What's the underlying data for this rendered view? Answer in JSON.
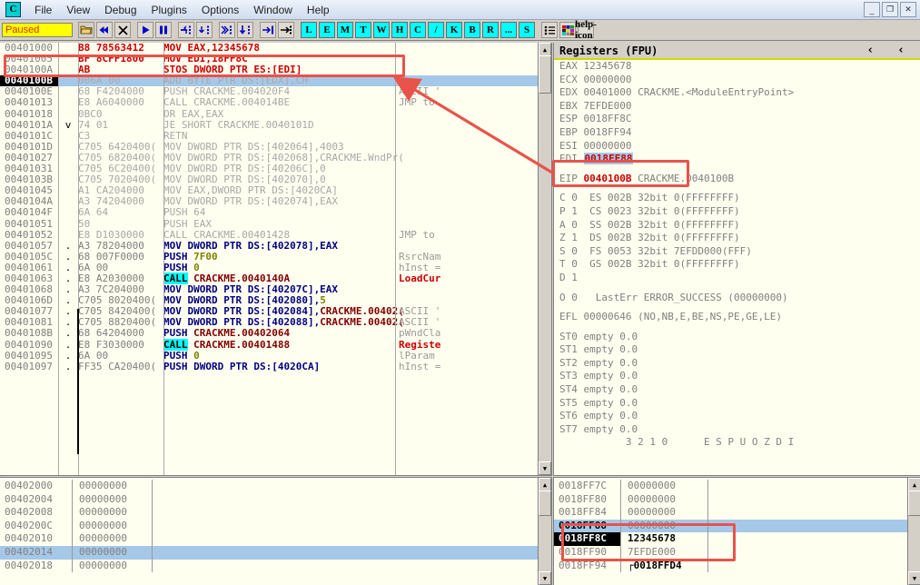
{
  "window": {
    "app_letter": "C",
    "menus": [
      "File",
      "View",
      "Debug",
      "Plugins",
      "Options",
      "Window",
      "Help"
    ],
    "controls": {
      "minimize": "_",
      "restore": "❐",
      "close": "✕"
    }
  },
  "toolbar": {
    "status": "Paused",
    "icons": [
      "open-folder",
      "restart",
      "close",
      "run",
      "pause",
      "step-over",
      "step-into",
      "trace-over",
      "trace-into",
      "execute-till-return",
      "animate"
    ],
    "letters": [
      "L",
      "E",
      "M",
      "T",
      "W",
      "H",
      "C",
      "/",
      "K",
      "B",
      "R",
      "...",
      "S"
    ],
    "extras": [
      "list-icon",
      "colors-icon",
      "help-icon"
    ]
  },
  "disasm": {
    "rows": [
      {
        "addr": "00401000",
        "mark": "",
        "hex": "B8 78563412",
        "hex_style": "red",
        "dis": "MOV EAX,12345678",
        "dis_style": "red",
        "cmt": ""
      },
      {
        "addr": "00401005",
        "mark": "",
        "hex": "BF 8CFF1800",
        "hex_style": "red",
        "dis": "MOV EDI,18FF8C",
        "dis_style": "red",
        "cmt": ""
      },
      {
        "addr": "0040100A",
        "mark": "",
        "hex": "AB",
        "hex_style": "red",
        "dis": "STOS DWORD PTR ES:[EDI]",
        "dis_style": "red",
        "cmt": ""
      },
      {
        "addr": "0040100B",
        "mark": "",
        "hex": "006A 00",
        "hex_style": "gray",
        "dis": "ADD BYTE PTR DS:[EDX],CH",
        "dis_style": "gray",
        "cmt": "",
        "current": true,
        "selected": true
      },
      {
        "addr": "0040100E",
        "mark": "",
        "hex": "68 F4204000",
        "hex_style": "gray",
        "dis": "PUSH CRACKME.004020F4",
        "dis_style": "gray",
        "cmt": "ASCII '"
      },
      {
        "addr": "00401013",
        "mark": "",
        "hex": "E8 A6040000",
        "hex_style": "gray",
        "dis": "CALL CRACKME.004014BE",
        "dis_style": "gray",
        "cmt": "JMP to"
      },
      {
        "addr": "00401018",
        "mark": "",
        "hex": "0BC0",
        "hex_style": "gray",
        "dis": "OR EAX,EAX",
        "dis_style": "gray",
        "cmt": ""
      },
      {
        "addr": "0040101A",
        "mark": "v",
        "hex": "74 01",
        "hex_style": "gray",
        "dis": "JE SHORT CRACKME.0040101D",
        "dis_style": "gray",
        "cmt": ""
      },
      {
        "addr": "0040101C",
        "mark": "",
        "hex": "C3",
        "hex_style": "gray",
        "dis": "RETN",
        "dis_style": "gray",
        "cmt": ""
      },
      {
        "addr": "0040101D",
        "mark": "",
        "hex": "C705 6420400(",
        "hex_style": "gray",
        "dis": "MOV DWORD PTR DS:[402064],4003",
        "dis_style": "gray",
        "cmt": ""
      },
      {
        "addr": "00401027",
        "mark": "",
        "hex": "C705 6820400(",
        "hex_style": "gray",
        "dis": "MOV DWORD PTR DS:[402068],CRACKME.WndPr(",
        "dis_style": "gray",
        "cmt": ""
      },
      {
        "addr": "00401031",
        "mark": "",
        "hex": "C705 6C20400(",
        "hex_style": "gray",
        "dis": "MOV DWORD PTR DS:[40206C],0",
        "dis_style": "gray",
        "cmt": ""
      },
      {
        "addr": "0040103B",
        "mark": "",
        "hex": "C705 7020400(",
        "hex_style": "gray",
        "dis": "MOV DWORD PTR DS:[402070],0",
        "dis_style": "gray",
        "cmt": ""
      },
      {
        "addr": "00401045",
        "mark": "",
        "hex": "A1 CA204000",
        "hex_style": "gray",
        "dis": "MOV EAX,DWORD PTR DS:[4020CA]",
        "dis_style": "gray",
        "cmt": ""
      },
      {
        "addr": "0040104A",
        "mark": "",
        "hex": "A3 74204000",
        "hex_style": "gray",
        "dis": "MOV DWORD PTR DS:[402074],EAX",
        "dis_style": "gray",
        "cmt": ""
      },
      {
        "addr": "0040104F",
        "mark": "",
        "hex": "6A 64",
        "hex_style": "gray",
        "dis": "PUSH 64",
        "dis_style": "gray",
        "cmt": ""
      },
      {
        "addr": "00401051",
        "mark": "",
        "hex": "50",
        "hex_style": "gray",
        "dis": "PUSH EAX",
        "dis_style": "gray",
        "cmt": ""
      },
      {
        "addr": "00401052",
        "mark": "",
        "hex": "E8 D1030000",
        "hex_style": "gray",
        "dis": "CALL CRACKME.00401428",
        "dis_style": "gray",
        "cmt": "JMP to"
      },
      {
        "addr": "00401057",
        "mark": ".",
        "hex": "A3 78204000",
        "hex_style": "dark",
        "dis": "MOV DWORD PTR DS:[402078],EAX",
        "dis_style": "navy",
        "cmt": ""
      },
      {
        "addr": "0040105C",
        "mark": ".",
        "hex": "68 007F0000",
        "hex_style": "dark",
        "dis": "PUSH 7F00",
        "dis_style": "push-olive",
        "cmt": "RsrcNam"
      },
      {
        "addr": "00401061",
        "mark": ".",
        "hex": "6A 00",
        "hex_style": "dark",
        "dis": "PUSH 0",
        "dis_style": "push-olive",
        "cmt": "hInst ="
      },
      {
        "addr": "00401063",
        "mark": ".",
        "hex": "E8 A2030000",
        "hex_style": "dark",
        "dis": "CALL CRACKME.0040140A",
        "dis_style": "call",
        "cmt": "LoadCur",
        "cmt_style": "red"
      },
      {
        "addr": "00401068",
        "mark": ".",
        "hex": "A3 7C204000",
        "hex_style": "dark",
        "dis": "MOV DWORD PTR DS:[40207C],EAX",
        "dis_style": "navy",
        "cmt": ""
      },
      {
        "addr": "0040106D",
        "mark": ".",
        "hex": "C705 8020400(",
        "hex_style": "dark",
        "dis": "MOV DWORD PTR DS:[402080],5",
        "dis_style": "navy-olive",
        "cmt": ""
      },
      {
        "addr": "00401077",
        "mark": ".",
        "hex": "C705 8420400(",
        "hex_style": "dark",
        "dis": "MOV DWORD PTR DS:[402084],CRACKME.00402(",
        "dis_style": "navy-maroon",
        "cmt": "ASCII '"
      },
      {
        "addr": "00401081",
        "mark": ".",
        "hex": "C705 8820400(",
        "hex_style": "dark",
        "dis": "MOV DWORD PTR DS:[402088],CRACKME.00402(",
        "dis_style": "navy-maroon",
        "cmt": "ASCII '"
      },
      {
        "addr": "0040108B",
        "mark": ".",
        "hex": "68 64204000",
        "hex_style": "dark",
        "dis": "PUSH CRACKME.00402064",
        "dis_style": "push-maroon",
        "cmt": "pWndCla"
      },
      {
        "addr": "00401090",
        "mark": ".",
        "hex": "E8 F3030000",
        "hex_style": "dark",
        "dis": "CALL CRACKME.00401488",
        "dis_style": "call",
        "cmt": "Registe",
        "cmt_style": "red"
      },
      {
        "addr": "00401095",
        "mark": ".",
        "hex": "6A 00",
        "hex_style": "dark",
        "dis": "PUSH 0",
        "dis_style": "push-olive",
        "cmt": "lParam"
      },
      {
        "addr": "00401097",
        "mark": ".",
        "hex": "FF35 CA20400(",
        "hex_style": "dark",
        "dis": "PUSH DWORD PTR DS:[4020CA]",
        "dis_style": "navy",
        "cmt": "hInst ="
      }
    ]
  },
  "registers": {
    "title": "Registers (FPU)",
    "gp": [
      {
        "name": "EAX",
        "value": "12345678",
        "note": ""
      },
      {
        "name": "ECX",
        "value": "00000000",
        "note": ""
      },
      {
        "name": "EDX",
        "value": "00401000",
        "note": "CRACKME.<ModuleEntryPoint>"
      },
      {
        "name": "EBX",
        "value": "7EFDE000",
        "note": ""
      },
      {
        "name": "ESP",
        "value": "0018FF8C",
        "note": ""
      },
      {
        "name": "EBP",
        "value": "0018FF94",
        "note": ""
      },
      {
        "name": "ESI",
        "value": "00000000",
        "note": ""
      },
      {
        "name": "EDI",
        "value": "0018FF88",
        "note": "",
        "highlight": true
      }
    ],
    "eip": {
      "name": "EIP",
      "value": "0040100B",
      "note": "CRACKME.0040100B"
    },
    "flags": [
      {
        "flag": "C",
        "bit": "0",
        "seg": "ES",
        "sel": "002B",
        "desc": "32bit 0(FFFFFFFF)"
      },
      {
        "flag": "P",
        "bit": "1",
        "seg": "CS",
        "sel": "0023",
        "desc": "32bit 0(FFFFFFFF)"
      },
      {
        "flag": "A",
        "bit": "0",
        "seg": "SS",
        "sel": "002B",
        "desc": "32bit 0(FFFFFFFF)"
      },
      {
        "flag": "Z",
        "bit": "1",
        "seg": "DS",
        "sel": "002B",
        "desc": "32bit 0(FFFFFFFF)"
      },
      {
        "flag": "S",
        "bit": "0",
        "seg": "FS",
        "sel": "0053",
        "desc": "32bit 7EFDD000(FFF)"
      },
      {
        "flag": "T",
        "bit": "0",
        "seg": "GS",
        "sel": "002B",
        "desc": "32bit 0(FFFFFFFF)"
      },
      {
        "flag": "D",
        "bit": "1",
        "seg": "",
        "sel": "",
        "desc": ""
      }
    ],
    "lasterr": "O 0   LastErr ERROR_SUCCESS (00000000)",
    "efl": "EFL 00000646 (NO,NB,E,BE,NS,PE,GE,LE)",
    "fpu": [
      "ST0 empty 0.0",
      "ST1 empty 0.0",
      "ST2 empty 0.0",
      "ST3 empty 0.0",
      "ST4 empty 0.0",
      "ST5 empty 0.0",
      "ST6 empty 0.0",
      "ST7 empty 0.0"
    ],
    "fpu_footer": "           3 2 1 0      E S P U O Z D I"
  },
  "dump": {
    "rows": [
      {
        "addr": "00402000",
        "value": "00000000"
      },
      {
        "addr": "00402004",
        "value": "00000000"
      },
      {
        "addr": "00402008",
        "value": "00000000"
      },
      {
        "addr": "0040200C",
        "value": "00000000"
      },
      {
        "addr": "00402010",
        "value": "00000000"
      },
      {
        "addr": "00402014",
        "value": "00000000",
        "selected": true
      },
      {
        "addr": "00402018",
        "value": "00000000"
      }
    ]
  },
  "stack": {
    "rows": [
      {
        "addr": "0018FF7C",
        "value": "00000000",
        "rest": ""
      },
      {
        "addr": "0018FF80",
        "value": "00000000",
        "rest": ""
      },
      {
        "addr": "0018FF84",
        "value": "00000000",
        "rest": ""
      },
      {
        "addr": "0018FF88",
        "value": "00000000",
        "rest": "",
        "selected": true,
        "addr_bold": true
      },
      {
        "addr": "0018FF8C",
        "value": "12345678",
        "rest": "",
        "current": true,
        "value_bold": true
      },
      {
        "addr": "0018FF90",
        "value": "7EFDE000",
        "rest": ""
      },
      {
        "addr": "0018FF94",
        "value": "0018FFD4",
        "rest": "",
        "bracket": true,
        "value_bold": true
      }
    ]
  },
  "annotations": {
    "boxes": [
      "disasm-mov-edi-row",
      "register-edi-value",
      "stack-ff88-ff8c-rows"
    ],
    "arrow": "arrow-from-edi-to-stos"
  }
}
